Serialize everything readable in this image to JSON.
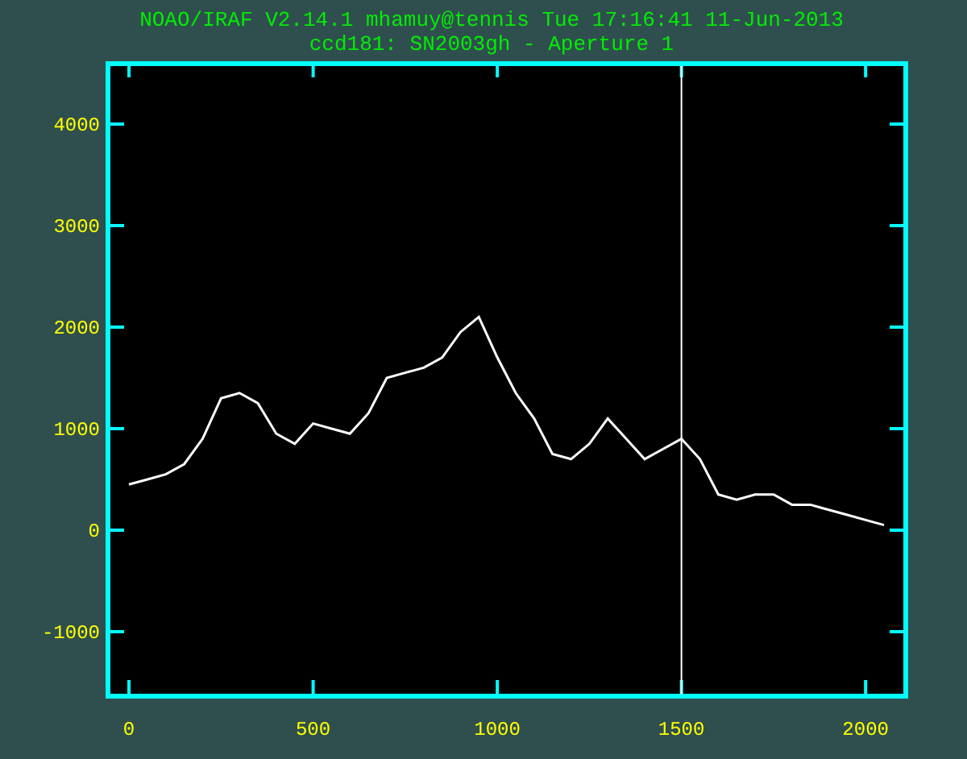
{
  "header": {
    "banner": "NOAO/IRAF V2.14.1 mhamuy@tennis Tue 17:16:41 11-Jun-2013"
  },
  "plot": {
    "chart_data": {
      "type": "line",
      "title": "ccd181: SN2003gh - Aperture 1",
      "x": [
        0,
        50,
        100,
        150,
        200,
        250,
        300,
        350,
        400,
        450,
        500,
        550,
        600,
        650,
        700,
        750,
        800,
        850,
        900,
        950,
        1000,
        1050,
        1100,
        1150,
        1200,
        1250,
        1300,
        1350,
        1400,
        1450,
        1500,
        1550,
        1600,
        1650,
        1700,
        1750,
        1800,
        1850,
        1900,
        1950,
        2000,
        2050
      ],
      "series": [
        {
          "color": "#ffffff",
          "values": [
            450,
            500,
            550,
            650,
            900,
            1300,
            1350,
            1250,
            950,
            850,
            1050,
            1000,
            950,
            1150,
            1500,
            1550,
            1600,
            1700,
            1950,
            2100,
            1700,
            1350,
            1100,
            750,
            700,
            850,
            1100,
            900,
            700,
            800,
            900,
            700,
            350,
            300,
            350,
            350,
            250,
            250,
            200,
            150,
            100,
            50
          ]
        }
      ],
      "xlim": [
        -57,
        2109
      ],
      "ylim": [
        -1635,
        4619
      ],
      "xticks": [
        0,
        500,
        1000,
        1500,
        2000
      ],
      "yticks": [
        -1000,
        0,
        1000,
        2000,
        3000,
        4000
      ],
      "ref_lines": [
        {
          "axis": "x",
          "value": 1500
        }
      ]
    }
  }
}
